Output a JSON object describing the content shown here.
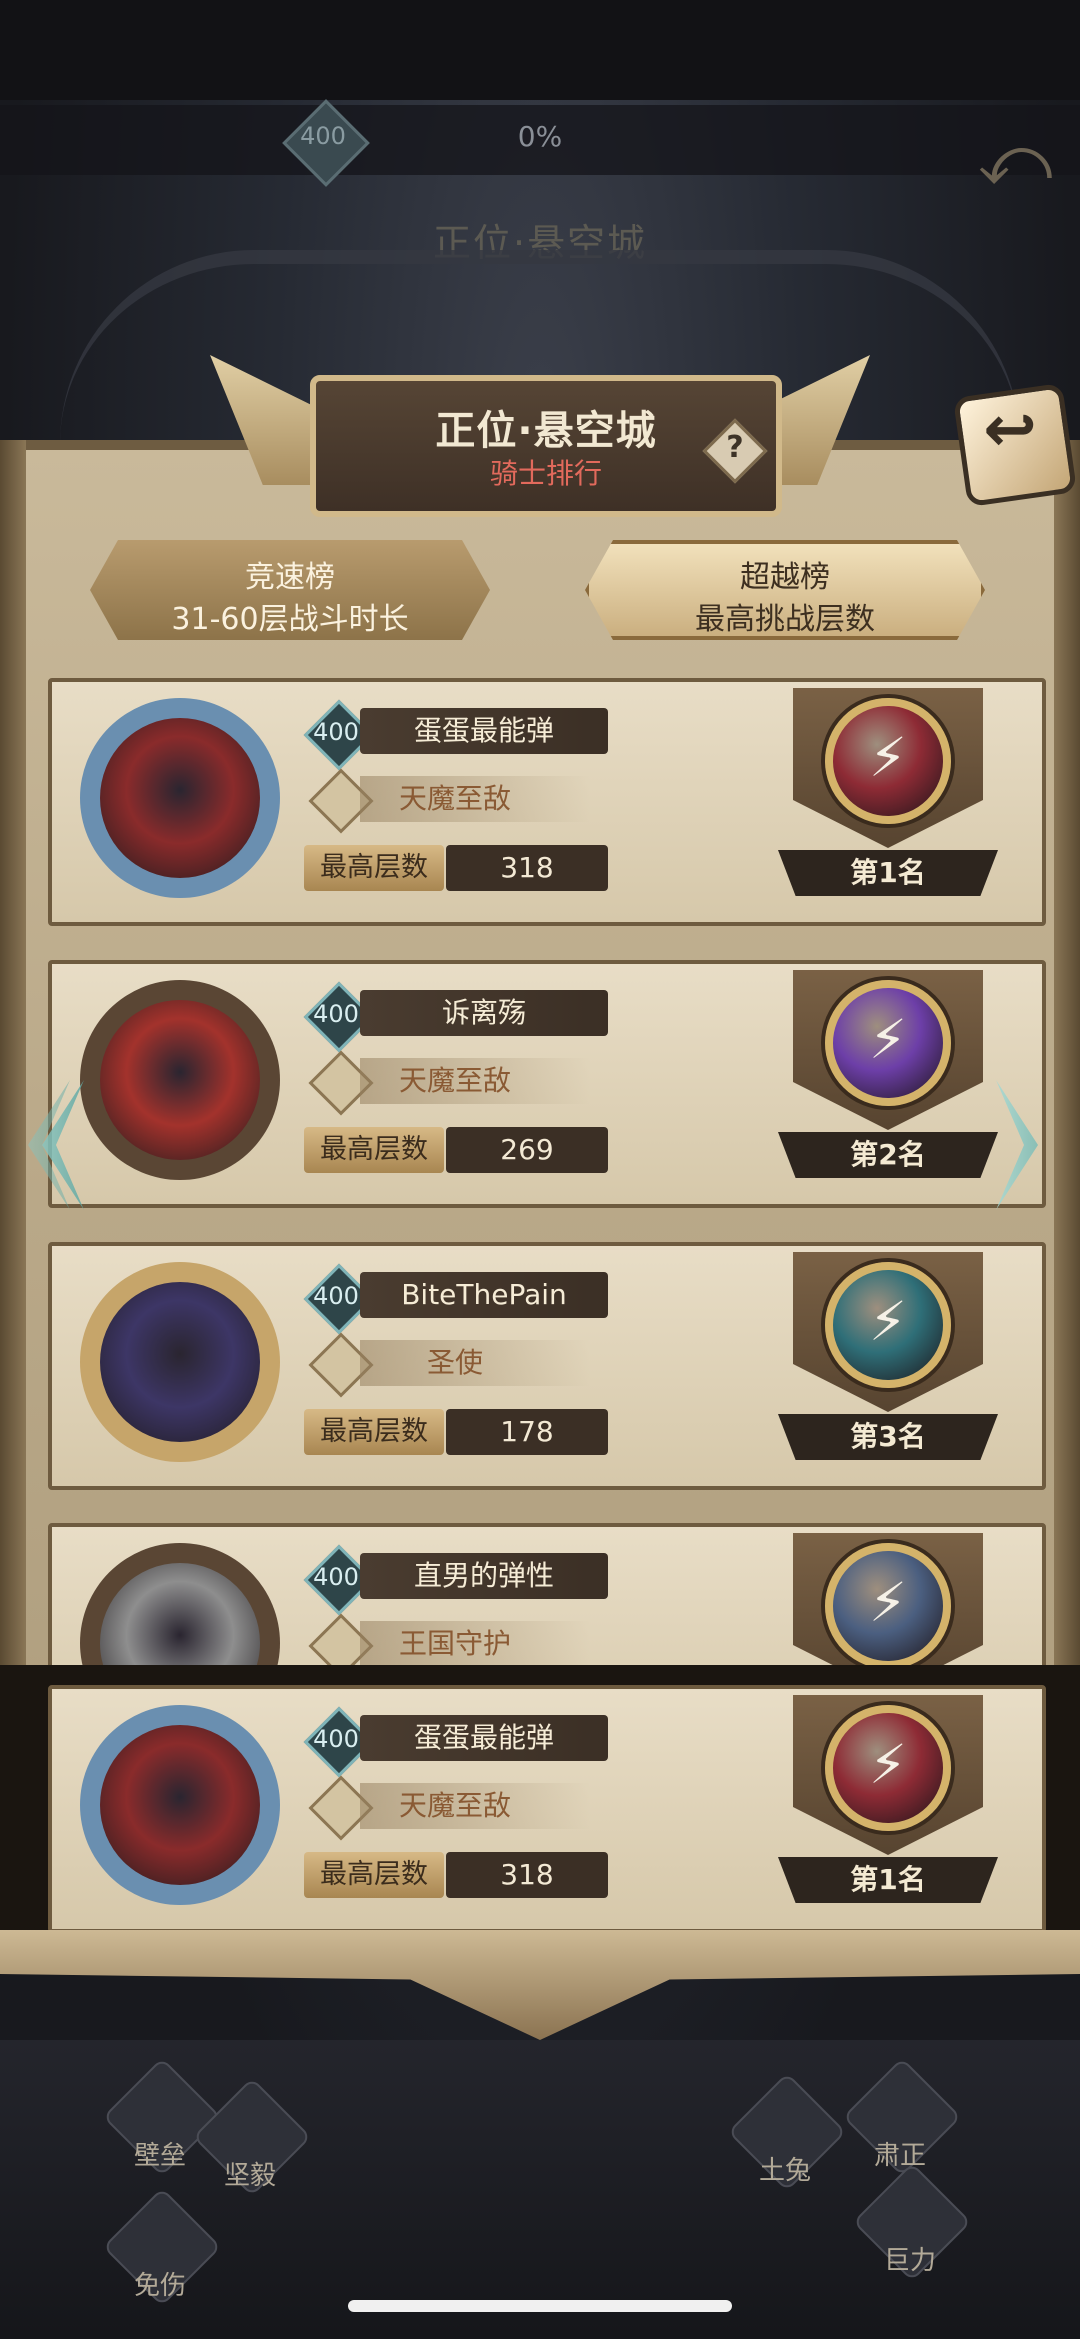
{
  "background": {
    "level": "400",
    "percent": "0%",
    "title": "正位·悬空城",
    "help": "?"
  },
  "header": {
    "title": "正位·悬空城",
    "subtitle": "骑士排行",
    "help": "?",
    "back_icon": "↩"
  },
  "tabs": [
    {
      "line1": "竞速榜",
      "line2": "31-60层战斗时长",
      "selected": false
    },
    {
      "line1": "超越榜",
      "line2": "最高挑战层数",
      "selected": true
    }
  ],
  "floors_label": "最高层数",
  "rankings": [
    {
      "level": "400",
      "name": "蛋蛋最能弹",
      "class": "天魔至敌",
      "floors": "318",
      "rank": "第1名",
      "gem_color": "#8e2b35",
      "avatar_color": "#8a2b2b",
      "frame_color": "#6a8fb0"
    },
    {
      "level": "400",
      "name": "诉离殇",
      "class": "天魔至敌",
      "floors": "269",
      "rank": "第2名",
      "gem_color": "#6d3fa8",
      "avatar_color": "#a3322c",
      "frame_color": "#5a4634"
    },
    {
      "level": "400",
      "name": "BiteThePain",
      "class": "圣使",
      "floors": "178",
      "rank": "第3名",
      "gem_color": "#2f6f78",
      "avatar_color": "#3d3666",
      "frame_color": "#c6a56a"
    },
    {
      "level": "400",
      "name": "直男的弹性",
      "class": "王国守护",
      "floors": "",
      "rank": "",
      "gem_color": "#4b5f80",
      "avatar_color": "#8e8e8e",
      "frame_color": "#5a4634"
    }
  ],
  "my_record": {
    "level": "400",
    "name": "蛋蛋最能弹",
    "class": "天魔至敌",
    "floors": "318",
    "rank": "第1名",
    "gem_color": "#8e2b35",
    "avatar_color": "#8a2b2b",
    "frame_color": "#6a8fb0"
  },
  "bottom_skills": [
    "壁垒",
    "坚毅",
    "免伤",
    "肃正",
    "土兔",
    "巨力"
  ]
}
